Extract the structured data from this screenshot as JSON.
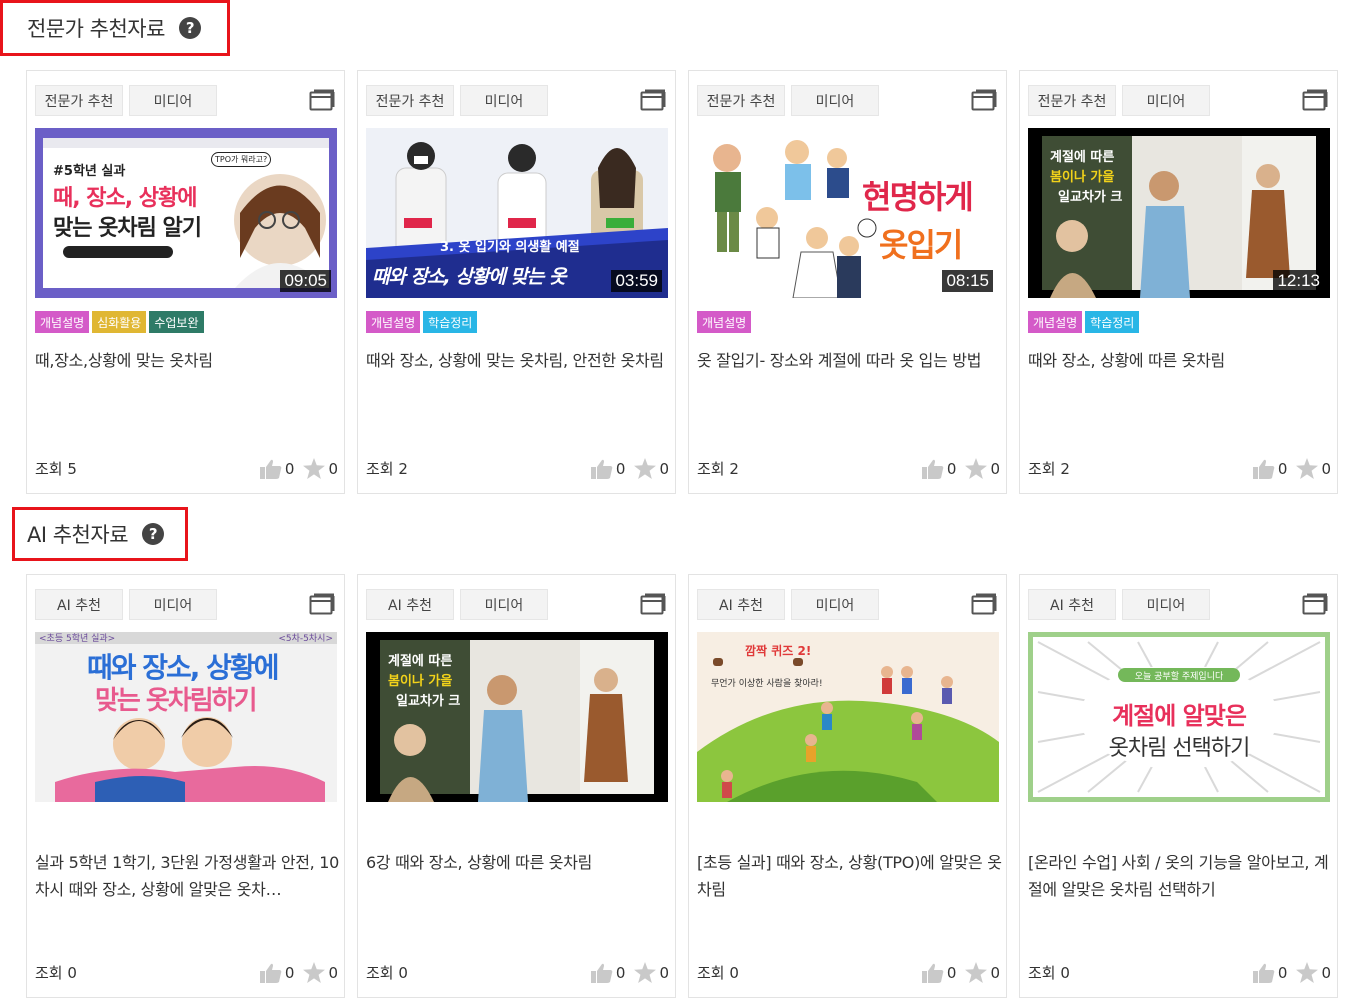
{
  "sections": [
    {
      "title": "전문가 추천자료",
      "help": "?",
      "cards": [
        {
          "tag": "전문가 추천",
          "type": "미디어",
          "duration": "09:05",
          "badges": [
            {
              "label": "개념설명",
              "color": "#d45ac8"
            },
            {
              "label": "심화활용",
              "color": "#e0b733"
            },
            {
              "label": "수업보완",
              "color": "#2e7b67"
            }
          ],
          "title": "때,장소,상황에 맞는 옷차림",
          "views": "조회 5",
          "likes": "0",
          "stars": "0",
          "thumb_text": [
            "#5학년 실과",
            "때, 장소, 상황에",
            "맞는 옷차림 알기",
            "TPO가 뭐라고?"
          ]
        },
        {
          "tag": "전문가 추천",
          "type": "미디어",
          "duration": "03:59",
          "badges": [
            {
              "label": "개념설명",
              "color": "#d45ac8"
            },
            {
              "label": "학습정리",
              "color": "#29b6e6"
            }
          ],
          "title": "때와 장소, 상황에 맞는 옷차림, 안전한 옷차림",
          "views": "조회 2",
          "likes": "0",
          "stars": "0",
          "thumb_text": [
            "3. 옷 입기와 의생활 예절",
            "때와 장소, 상황에 맞는 옷"
          ]
        },
        {
          "tag": "전문가 추천",
          "type": "미디어",
          "duration": "08:15",
          "badges": [
            {
              "label": "개념설명",
              "color": "#d45ac8"
            }
          ],
          "title": "옷 잘입기- 장소와 계절에 따라 옷 입는 방법",
          "views": "조회 2",
          "likes": "0",
          "stars": "0",
          "thumb_text": [
            "현명하게",
            "옷입기"
          ]
        },
        {
          "tag": "전문가 추천",
          "type": "미디어",
          "duration": "12:13",
          "badges": [
            {
              "label": "개념설명",
              "color": "#d45ac8"
            },
            {
              "label": "학습정리",
              "color": "#29b6e6"
            }
          ],
          "title": "때와 장소, 상황에 따른 옷차림",
          "views": "조회 2",
          "likes": "0",
          "stars": "0",
          "thumb_text": [
            "계절에 따른",
            "봄이나 가을",
            "일교차가 크"
          ]
        }
      ]
    },
    {
      "title": "AI 추천자료",
      "help": "?",
      "cards": [
        {
          "tag": "AI 추천",
          "type": "미디어",
          "title": "실과 5학년 1학기, 3단원 가정생활과 안전, 10차시 때와 장소, 상황에 알맞은 옷차…",
          "views": "조회 0",
          "likes": "0",
          "stars": "0",
          "thumb_text": [
            "<초등 5학년 실과>",
            "<5차-5차시>",
            "때와 장소, 상황에",
            "맞는 옷차림하기"
          ]
        },
        {
          "tag": "AI 추천",
          "type": "미디어",
          "title": "6강 때와 장소, 상황에 따른 옷차림",
          "views": "조회 0",
          "likes": "0",
          "stars": "0",
          "thumb_text": [
            "계절에 따른",
            "봄이나 가을",
            "일교차가 크"
          ]
        },
        {
          "tag": "AI 추천",
          "type": "미디어",
          "title": "[초등 실과] 때와 장소, 상황(TPO)에 알맞은 옷차림",
          "views": "조회 0",
          "likes": "0",
          "stars": "0",
          "thumb_text": [
            "깜짝 퀴즈 2!",
            "무언가 이상한 사람을 찾아라!"
          ]
        },
        {
          "tag": "AI 추천",
          "type": "미디어",
          "title": "[온라인 수업] 사회 / 옷의 기능을 알아보고, 계절에 알맞은 옷차림 선택하기",
          "views": "조회 0",
          "likes": "0",
          "stars": "0",
          "thumb_text": [
            "오늘 공부할 주제입니다",
            "계절에 알맞은",
            "옷차림 선택하기"
          ]
        }
      ]
    }
  ]
}
